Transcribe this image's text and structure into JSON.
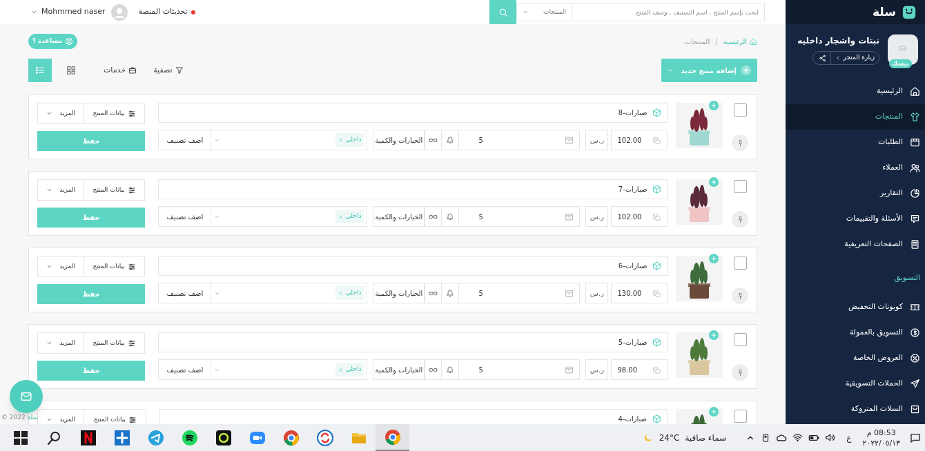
{
  "topbar": {
    "search_placeholder": "ابحث بإسم المنتج , اسم التصنيف , وصف المنتج",
    "search_scope": "المنتجات",
    "updates": "تحديثات المنصة",
    "user": "Mohmmed naser"
  },
  "breadcrumb": [
    {
      "label": "الرئيسية",
      "kind": "home"
    },
    {
      "label": "المنتجات",
      "kind": "current",
      "separator": "/"
    }
  ],
  "help": "مساعدة ؟",
  "toolbar": {
    "add_product": "إضافة منتج جديد",
    "filter": "تصفية",
    "services": "خدمات",
    "views": [
      {
        "kind": "grid",
        "selected": false
      },
      {
        "kind": "list",
        "selected": true
      }
    ]
  },
  "products": [
    {
      "name": "صبارات-8",
      "checked": false,
      "price": "102.00",
      "currency": "ر.س",
      "quantity": "5",
      "options": "الخيارات والكمية",
      "tags": [
        "داخلي"
      ],
      "add_category": "اضف تصنيف",
      "details": "بيانات المنتج",
      "more": "المزيد",
      "save": "حفظ"
    },
    {
      "name": "صبارات-7",
      "checked": false,
      "price": "102.00",
      "currency": "ر.س",
      "quantity": "5",
      "options": "الخيارات والكمية",
      "tags": [
        "داخلي"
      ],
      "add_category": "اضف تصنيف",
      "details": "بيانات المنتج",
      "more": "المزيد",
      "save": "حفظ"
    },
    {
      "name": "صبارات-6",
      "checked": false,
      "price": "130.00",
      "currency": "ر.س",
      "quantity": "5",
      "options": "الخيارات والكمية",
      "tags": [
        "داخلي"
      ],
      "add_category": "اضف تصنيف",
      "details": "بيانات المنتج",
      "more": "المزيد",
      "save": "حفظ"
    },
    {
      "name": "صبارات-5",
      "checked": false,
      "price": "98.00",
      "currency": "ر.س",
      "quantity": "5",
      "options": "الخيارات والكمية",
      "tags": [
        "داخلي"
      ],
      "add_category": "اضف تصنيف",
      "details": "بيانات المنتج",
      "more": "المزيد",
      "save": "حفظ"
    },
    {
      "name": "صبارات-4",
      "checked": false,
      "details": "بيانات المنتج",
      "more": "المزيد"
    }
  ],
  "footer": {
    "brand": "سلة",
    "copyright": "© 2022"
  },
  "sidebar": {
    "brand": "سلة",
    "store_name": "نبتات واشجار داخليه",
    "plan_badge": "بيسك",
    "visit_store": "زيارة المتجر",
    "nav": [
      {
        "label": "الرئيسية",
        "selected": false
      },
      {
        "label": "المنتجات",
        "selected": true
      },
      {
        "label": "الطلبات",
        "selected": false
      },
      {
        "label": "العملاء",
        "selected": false
      },
      {
        "label": "التقارير",
        "selected": false
      },
      {
        "label": "الأسئلة والتقييمات",
        "selected": false
      },
      {
        "label": "الصفحات التعريفية",
        "selected": false
      }
    ],
    "section_title": "التسويق",
    "marketing": [
      {
        "label": "كوبونات التخفيض",
        "selected": false
      },
      {
        "label": "التسويق بالعمولة",
        "selected": false
      },
      {
        "label": "العروض الخاصة",
        "selected": false
      },
      {
        "label": "الحملات التسويقية",
        "selected": false
      },
      {
        "label": "السلات المتروكة",
        "selected": false
      }
    ]
  },
  "taskbar": {
    "apps": [
      {
        "kind": "start"
      },
      {
        "kind": "search"
      },
      {
        "kind": "netflix"
      },
      {
        "kind": "plus"
      },
      {
        "kind": "telegram"
      },
      {
        "kind": "spotify"
      },
      {
        "kind": "ring"
      },
      {
        "kind": "zoom"
      },
      {
        "kind": "chrome"
      },
      {
        "kind": "sync"
      },
      {
        "kind": "folder"
      },
      {
        "kind": "chrome"
      }
    ],
    "weather": "سماء صافية",
    "temperature": "24°C",
    "language": "ع",
    "time": "08:53 م",
    "date": "٢٠٢٢/٠٥/١٣"
  }
}
